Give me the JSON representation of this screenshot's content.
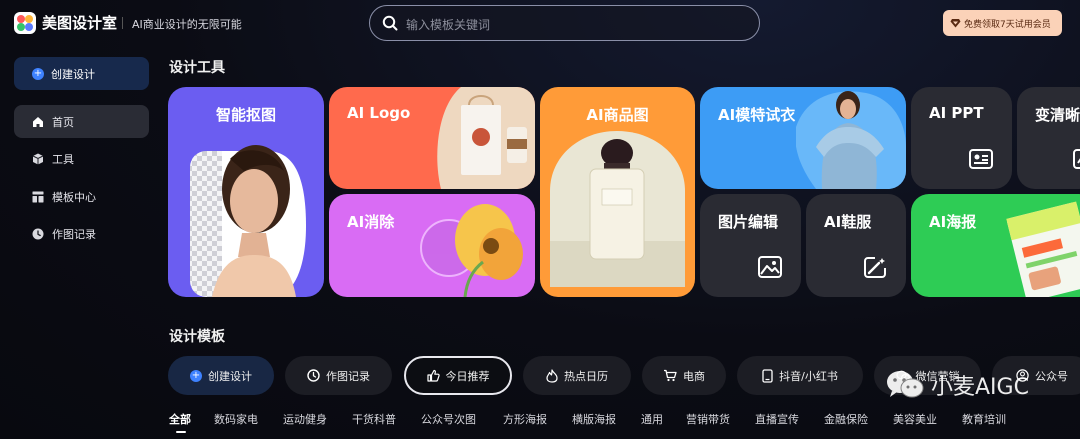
{
  "header": {
    "brand": "美图设计室",
    "slogan": "AI商业设计的无限可能",
    "search_placeholder": "输入模板关键词",
    "vip_label": "免费领取7天试用会员"
  },
  "sidebar": {
    "create_label": "创建设计",
    "items": [
      {
        "label": "首页",
        "icon": "home-icon",
        "active": true
      },
      {
        "label": "工具",
        "icon": "cube-icon",
        "active": false
      },
      {
        "label": "模板中心",
        "icon": "template-icon",
        "active": false
      },
      {
        "label": "作图记录",
        "icon": "clock-icon",
        "active": false
      }
    ]
  },
  "tools_section": {
    "title": "设计工具",
    "cards": [
      {
        "label": "智能抠图",
        "color": "#6c5cf0"
      },
      {
        "label": "AI Logo",
        "color": "#ff6a4d"
      },
      {
        "label": "AI消除",
        "color": "#d66ef5"
      },
      {
        "label": "AI商品图",
        "color": "#ff9b38"
      },
      {
        "label": "AI模特试衣",
        "color": "#3d9cf5"
      },
      {
        "label": "AI PPT",
        "color": "#2a2b33"
      },
      {
        "label": "变清晰",
        "color": "#2a2b33"
      },
      {
        "label": "图片编辑",
        "color": "#2a2b33"
      },
      {
        "label": "AI鞋服",
        "color": "#2a2b33"
      },
      {
        "label": "AI海报",
        "color": "#2ecc55"
      }
    ]
  },
  "templates_section": {
    "title": "设计模板",
    "pills": [
      {
        "label": "创建设计",
        "icon": "plus-icon"
      },
      {
        "label": "作图记录",
        "icon": "clock-icon"
      },
      {
        "label": "今日推荐",
        "icon": "thumbs-up-icon"
      },
      {
        "label": "热点日历",
        "icon": "flame-icon"
      },
      {
        "label": "电商",
        "icon": "cart-icon"
      },
      {
        "label": "抖音/小红书",
        "icon": "phone-icon"
      },
      {
        "label": "微信营销",
        "icon": "wechat-icon"
      },
      {
        "label": "公众号",
        "icon": "user-icon"
      }
    ],
    "categories": [
      "全部",
      "数码家电",
      "运动健身",
      "干货科普",
      "公众号次图",
      "方形海报",
      "横版海报",
      "通用",
      "营销带货",
      "直播宣传",
      "金融保险",
      "美容美业",
      "教育培训"
    ]
  },
  "watermark": {
    "text": "小麦AIGC"
  }
}
